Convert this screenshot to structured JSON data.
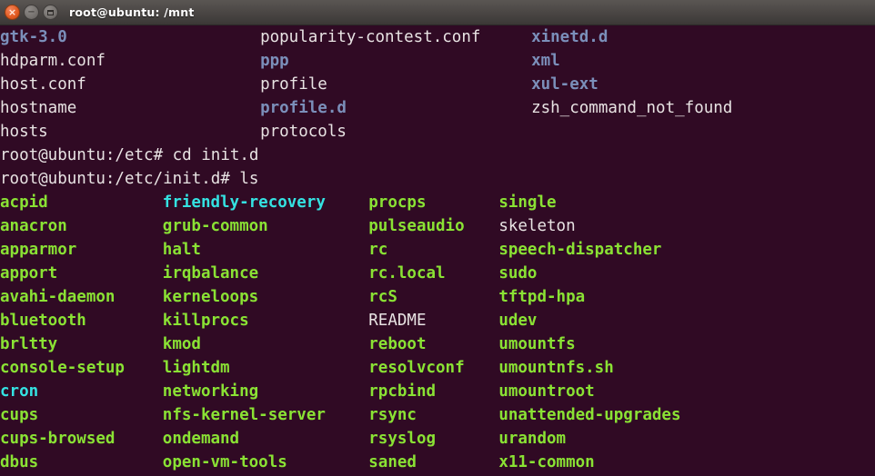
{
  "window": {
    "title": "root@ubuntu: /mnt",
    "controls": [
      {
        "name": "close",
        "glyph": "×"
      },
      {
        "name": "minimize",
        "glyph": "−"
      },
      {
        "name": "maximize",
        "glyph": ""
      }
    ]
  },
  "terminal": {
    "background_color": "#300a24",
    "foreground_color": "#e8e3e3",
    "dir_color": "#7b8fba",
    "exec_color": "#8ae234",
    "link_color": "#34e2e2",
    "char_width": 11.92,
    "line_height": 26,
    "lines": [
      {
        "type": "listing",
        "cells": [
          {
            "col": 0,
            "text": "gtk-3.0",
            "kind": "dir"
          },
          {
            "col": 24,
            "text": "popularity-contest.conf",
            "kind": "file"
          },
          {
            "col": 49,
            "text": "xinetd.d",
            "kind": "dir"
          }
        ]
      },
      {
        "type": "listing",
        "cells": [
          {
            "col": 0,
            "text": "hdparm.conf",
            "kind": "file"
          },
          {
            "col": 24,
            "text": "ppp",
            "kind": "dir"
          },
          {
            "col": 49,
            "text": "xml",
            "kind": "dir"
          }
        ]
      },
      {
        "type": "listing",
        "cells": [
          {
            "col": 0,
            "text": "host.conf",
            "kind": "file"
          },
          {
            "col": 24,
            "text": "profile",
            "kind": "file"
          },
          {
            "col": 49,
            "text": "xul-ext",
            "kind": "dir"
          }
        ]
      },
      {
        "type": "listing",
        "cells": [
          {
            "col": 0,
            "text": "hostname",
            "kind": "file"
          },
          {
            "col": 24,
            "text": "profile.d",
            "kind": "dir"
          },
          {
            "col": 49,
            "text": "zsh_command_not_found",
            "kind": "file"
          }
        ]
      },
      {
        "type": "listing",
        "cells": [
          {
            "col": 0,
            "text": "hosts",
            "kind": "file"
          },
          {
            "col": 24,
            "text": "protocols",
            "kind": "file"
          }
        ]
      },
      {
        "type": "prompt",
        "cells": [
          {
            "col": 0,
            "text": "root@ubuntu:/etc# cd init.d",
            "kind": "prompt"
          }
        ]
      },
      {
        "type": "prompt",
        "cells": [
          {
            "col": 0,
            "text": "root@ubuntu:/etc/init.d# ls",
            "kind": "prompt"
          }
        ]
      },
      {
        "type": "listing",
        "cells": [
          {
            "col": 0,
            "text": "acpid",
            "kind": "exec"
          },
          {
            "col": 15,
            "text": "friendly-recovery",
            "kind": "link"
          },
          {
            "col": 34,
            "text": "procps",
            "kind": "exec"
          },
          {
            "col": 46,
            "text": "single",
            "kind": "exec"
          }
        ]
      },
      {
        "type": "listing",
        "cells": [
          {
            "col": 0,
            "text": "anacron",
            "kind": "exec"
          },
          {
            "col": 15,
            "text": "grub-common",
            "kind": "exec"
          },
          {
            "col": 34,
            "text": "pulseaudio",
            "kind": "exec"
          },
          {
            "col": 46,
            "text": "skeleton",
            "kind": "file"
          }
        ]
      },
      {
        "type": "listing",
        "cells": [
          {
            "col": 0,
            "text": "apparmor",
            "kind": "exec"
          },
          {
            "col": 15,
            "text": "halt",
            "kind": "exec"
          },
          {
            "col": 34,
            "text": "rc",
            "kind": "exec"
          },
          {
            "col": 46,
            "text": "speech-dispatcher",
            "kind": "exec"
          }
        ]
      },
      {
        "type": "listing",
        "cells": [
          {
            "col": 0,
            "text": "apport",
            "kind": "exec"
          },
          {
            "col": 15,
            "text": "irqbalance",
            "kind": "exec"
          },
          {
            "col": 34,
            "text": "rc.local",
            "kind": "exec"
          },
          {
            "col": 46,
            "text": "sudo",
            "kind": "exec"
          }
        ]
      },
      {
        "type": "listing",
        "cells": [
          {
            "col": 0,
            "text": "avahi-daemon",
            "kind": "exec"
          },
          {
            "col": 15,
            "text": "kerneloops",
            "kind": "exec"
          },
          {
            "col": 34,
            "text": "rcS",
            "kind": "exec"
          },
          {
            "col": 46,
            "text": "tftpd-hpa",
            "kind": "exec"
          }
        ]
      },
      {
        "type": "listing",
        "cells": [
          {
            "col": 0,
            "text": "bluetooth",
            "kind": "exec"
          },
          {
            "col": 15,
            "text": "killprocs",
            "kind": "exec"
          },
          {
            "col": 34,
            "text": "README",
            "kind": "file"
          },
          {
            "col": 46,
            "text": "udev",
            "kind": "exec"
          }
        ]
      },
      {
        "type": "listing",
        "cells": [
          {
            "col": 0,
            "text": "brltty",
            "kind": "exec"
          },
          {
            "col": 15,
            "text": "kmod",
            "kind": "exec"
          },
          {
            "col": 34,
            "text": "reboot",
            "kind": "exec"
          },
          {
            "col": 46,
            "text": "umountfs",
            "kind": "exec"
          }
        ]
      },
      {
        "type": "listing",
        "cells": [
          {
            "col": 0,
            "text": "console-setup",
            "kind": "exec"
          },
          {
            "col": 15,
            "text": "lightdm",
            "kind": "exec"
          },
          {
            "col": 34,
            "text": "resolvconf",
            "kind": "exec"
          },
          {
            "col": 46,
            "text": "umountnfs.sh",
            "kind": "exec"
          }
        ]
      },
      {
        "type": "listing",
        "cells": [
          {
            "col": 0,
            "text": "cron",
            "kind": "link"
          },
          {
            "col": 15,
            "text": "networking",
            "kind": "exec"
          },
          {
            "col": 34,
            "text": "rpcbind",
            "kind": "exec"
          },
          {
            "col": 46,
            "text": "umountroot",
            "kind": "exec"
          }
        ]
      },
      {
        "type": "listing",
        "cells": [
          {
            "col": 0,
            "text": "cups",
            "kind": "exec"
          },
          {
            "col": 15,
            "text": "nfs-kernel-server",
            "kind": "exec"
          },
          {
            "col": 34,
            "text": "rsync",
            "kind": "exec"
          },
          {
            "col": 46,
            "text": "unattended-upgrades",
            "kind": "exec"
          }
        ]
      },
      {
        "type": "listing",
        "cells": [
          {
            "col": 0,
            "text": "cups-browsed",
            "kind": "exec"
          },
          {
            "col": 15,
            "text": "ondemand",
            "kind": "exec"
          },
          {
            "col": 34,
            "text": "rsyslog",
            "kind": "exec"
          },
          {
            "col": 46,
            "text": "urandom",
            "kind": "exec"
          }
        ]
      },
      {
        "type": "listing",
        "cells": [
          {
            "col": 0,
            "text": "dbus",
            "kind": "exec"
          },
          {
            "col": 15,
            "text": "open-vm-tools",
            "kind": "exec"
          },
          {
            "col": 34,
            "text": "saned",
            "kind": "exec"
          },
          {
            "col": 46,
            "text": "x11-common",
            "kind": "exec"
          }
        ]
      }
    ]
  }
}
